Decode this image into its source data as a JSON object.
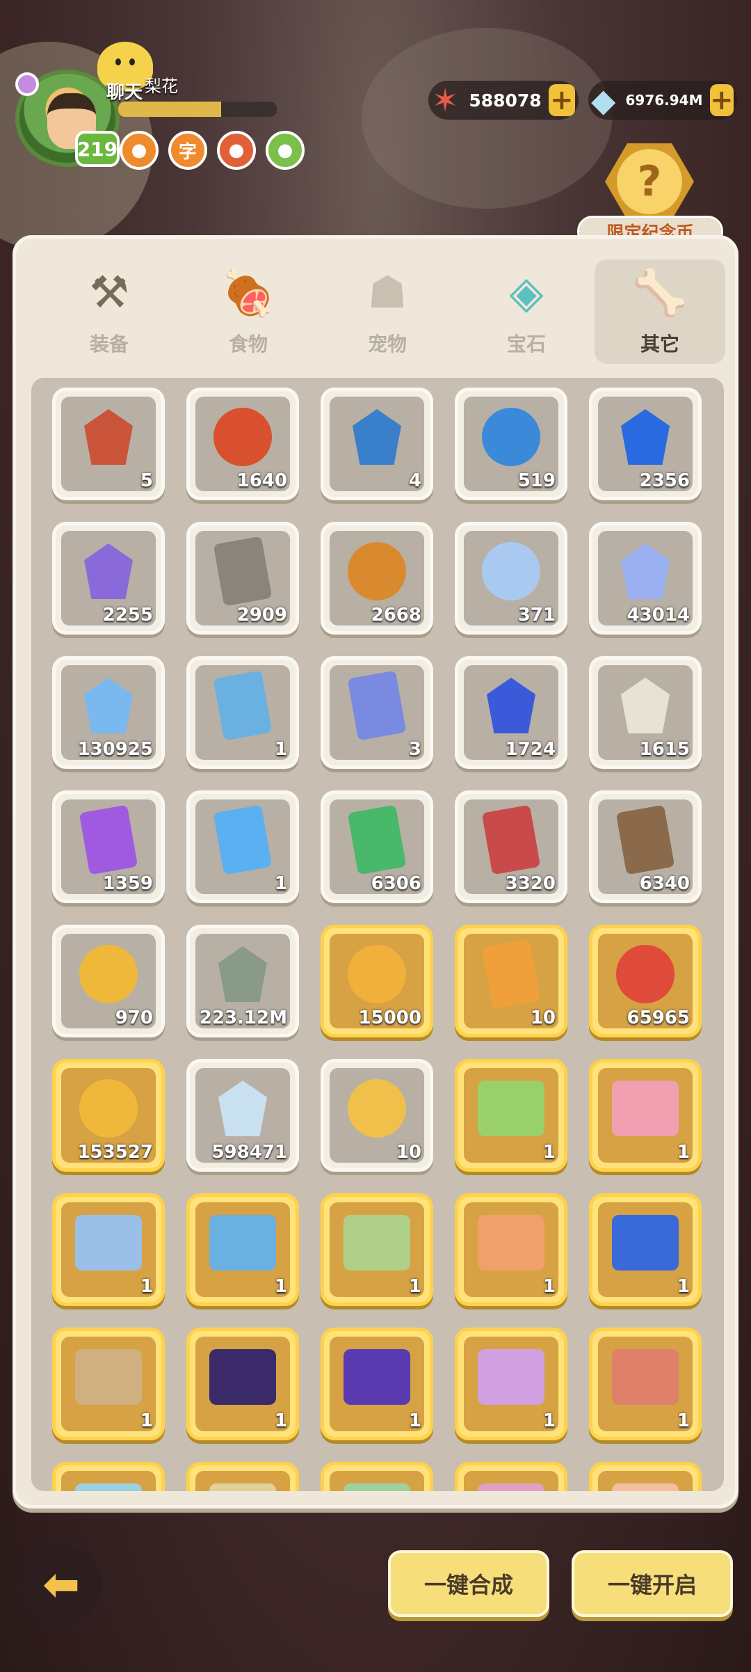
{
  "player": {
    "chat_label": "聊天",
    "name": "梨花",
    "level": "219",
    "badges": [
      "●",
      "●",
      "字",
      "●",
      "●"
    ]
  },
  "currencies": [
    {
      "icon": "starfish-icon",
      "glyph": "✶",
      "value": "588078"
    },
    {
      "icon": "crystal-icon",
      "glyph": "◆",
      "value": "6976.94M"
    }
  ],
  "plus_label": "+",
  "limited": {
    "glyph": "?",
    "label": "限定纪念币"
  },
  "tabs": [
    {
      "label": "装备",
      "glyph": "⚒"
    },
    {
      "label": "食物",
      "glyph": "🍖"
    },
    {
      "label": "宠物",
      "glyph": "☗"
    },
    {
      "label": "宝石",
      "glyph": "◈"
    },
    {
      "label": "其它",
      "glyph": "🦴"
    }
  ],
  "active_tab": 4,
  "items": [
    {
      "count": "5",
      "icon": "dino-egg-shard-icon",
      "gold": false,
      "color": "#c9543a",
      "shape": "gem"
    },
    {
      "count": "1640",
      "icon": "red-dino-egg-icon",
      "gold": false,
      "color": "#d9502e",
      "shape": "round"
    },
    {
      "count": "4",
      "icon": "blue-dino-shard-icon",
      "gold": false,
      "color": "#3a7fc9",
      "shape": "gem"
    },
    {
      "count": "519",
      "icon": "blue-dino-egg-icon",
      "gold": false,
      "color": "#3a8ad9",
      "shape": "round"
    },
    {
      "count": "2356",
      "icon": "blue-crystal-icon",
      "gold": false,
      "color": "#2a6ae0",
      "shape": "gem"
    },
    {
      "count": "2255",
      "icon": "purple-crystal-icon",
      "gold": false,
      "color": "#8a6ad9",
      "shape": "gem"
    },
    {
      "count": "2909",
      "icon": "stone-tablet-icon",
      "gold": false,
      "color": "#8a847c",
      "shape": "cardshape"
    },
    {
      "count": "2668",
      "icon": "food-plate-icon",
      "gold": false,
      "color": "#d98a2e",
      "shape": "round"
    },
    {
      "count": "371",
      "icon": "moon-icon",
      "gold": false,
      "color": "#a9c9f0",
      "shape": "round"
    },
    {
      "count": "43014",
      "icon": "star-icon",
      "gold": false,
      "color": "#9ab0f0",
      "shape": "gem"
    },
    {
      "count": "130925",
      "icon": "prism-gem-icon",
      "gold": false,
      "color": "#7ab8f0",
      "shape": "gem"
    },
    {
      "count": "1",
      "icon": "gender-card-icon",
      "gold": false,
      "color": "#6ab0e0",
      "shape": "cardshape"
    },
    {
      "count": "3",
      "icon": "pet-card-icon",
      "gold": false,
      "color": "#7a8ae0",
      "shape": "cardshape"
    },
    {
      "count": "1724",
      "icon": "blue-rune-crystal-icon",
      "gold": false,
      "color": "#3a5ad9",
      "shape": "gem"
    },
    {
      "count": "1615",
      "icon": "dice-icon",
      "gold": false,
      "color": "#e8e2d6",
      "shape": "gem"
    },
    {
      "count": "1359",
      "icon": "purple-ticket-icon",
      "gold": false,
      "color": "#a05ae0",
      "shape": "cardshape"
    },
    {
      "count": "1",
      "icon": "blue-ticket-icon",
      "gold": false,
      "color": "#5ab0f0",
      "shape": "cardshape"
    },
    {
      "count": "6306",
      "icon": "green-ticket-icon",
      "gold": false,
      "color": "#4ab86a",
      "shape": "cardshape"
    },
    {
      "count": "3320",
      "icon": "red-ticket-icon",
      "gold": false,
      "color": "#c94a4a",
      "shape": "cardshape"
    },
    {
      "count": "6340",
      "icon": "brown-ticket-icon",
      "gold": false,
      "color": "#8a6a4a",
      "shape": "cardshape"
    },
    {
      "count": "970",
      "icon": "shell-coin-icon",
      "gold": false,
      "color": "#f0b83a",
      "shape": "round"
    },
    {
      "count": "223.12M",
      "icon": "stone-rune-icon",
      "gold": false,
      "color": "#8a9a8a",
      "shape": "gem"
    },
    {
      "count": "15000",
      "icon": "food-coin-icon",
      "gold": true,
      "color": "#f0b03a",
      "shape": "round"
    },
    {
      "count": "10",
      "icon": "paw-ticket-icon",
      "gold": true,
      "color": "#f0a03a",
      "shape": "cardshape"
    },
    {
      "count": "65965",
      "icon": "red-spiral-coin-icon",
      "gold": true,
      "color": "#e04a3a",
      "shape": "round"
    },
    {
      "count": "153527",
      "icon": "gold-coin-icon",
      "gold": true,
      "color": "#f0b83a",
      "shape": "round"
    },
    {
      "count": "598471",
      "icon": "rainbow-crystal-icon",
      "gold": false,
      "color": "#c9e0f0",
      "shape": "gem"
    },
    {
      "count": "10",
      "icon": "bowl-icon",
      "gold": false,
      "color": "#f0c04a",
      "shape": "round"
    },
    {
      "count": "1",
      "icon": "anniversary-6-icon",
      "gold": true,
      "color": "#9ad06a",
      "shape": "scene"
    },
    {
      "count": "1",
      "icon": "anniversary-5-icon",
      "gold": true,
      "color": "#f0a0b0",
      "shape": "scene"
    },
    {
      "count": "1",
      "icon": "anniversary-4-icon",
      "gold": true,
      "color": "#9ac0e8",
      "shape": "scene"
    },
    {
      "count": "1",
      "icon": "anniversary-rainbow-icon",
      "gold": true,
      "color": "#6ab0e0",
      "shape": "scene"
    },
    {
      "count": "1",
      "icon": "anniversary-3-icon",
      "gold": true,
      "color": "#b0d08a",
      "shape": "scene"
    },
    {
      "count": "1",
      "icon": "photo-card-icon",
      "gold": true,
      "color": "#f0a06a",
      "shape": "scene"
    },
    {
      "count": "1",
      "icon": "sonic-card-icon",
      "gold": true,
      "color": "#3a6ad9",
      "shape": "scene"
    },
    {
      "count": "1",
      "icon": "desert-scene-icon",
      "gold": true,
      "color": "#d0b080",
      "shape": "scene"
    },
    {
      "count": "1",
      "icon": "space-card-icon",
      "gold": true,
      "color": "#3a2a6a",
      "shape": "scene"
    },
    {
      "count": "1",
      "icon": "purple-card-icon",
      "gold": true,
      "color": "#5a3ab0",
      "shape": "scene"
    },
    {
      "count": "1",
      "icon": "party-card-icon",
      "gold": true,
      "color": "#d0a0e0",
      "shape": "scene"
    },
    {
      "count": "1",
      "icon": "stamp-card-icon",
      "gold": true,
      "color": "#e0806a",
      "shape": "scene"
    },
    {
      "count": "",
      "icon": "scene-card-icon",
      "gold": true,
      "color": "#9ad0e0",
      "shape": "scene"
    },
    {
      "count": "",
      "icon": "scene-card-icon",
      "gold": true,
      "color": "#e0d09a",
      "shape": "scene"
    },
    {
      "count": "",
      "icon": "scene-card-icon",
      "gold": true,
      "color": "#a0d0a0",
      "shape": "scene"
    },
    {
      "count": "",
      "icon": "scene-card-icon",
      "gold": true,
      "color": "#e0a0c0",
      "shape": "scene"
    },
    {
      "count": "",
      "icon": "scene-card-icon",
      "gold": true,
      "color": "#f0c0a0",
      "shape": "scene"
    }
  ],
  "back_glyph": "⬅",
  "buttons": {
    "combine": "一键合成",
    "open": "一键开启"
  }
}
